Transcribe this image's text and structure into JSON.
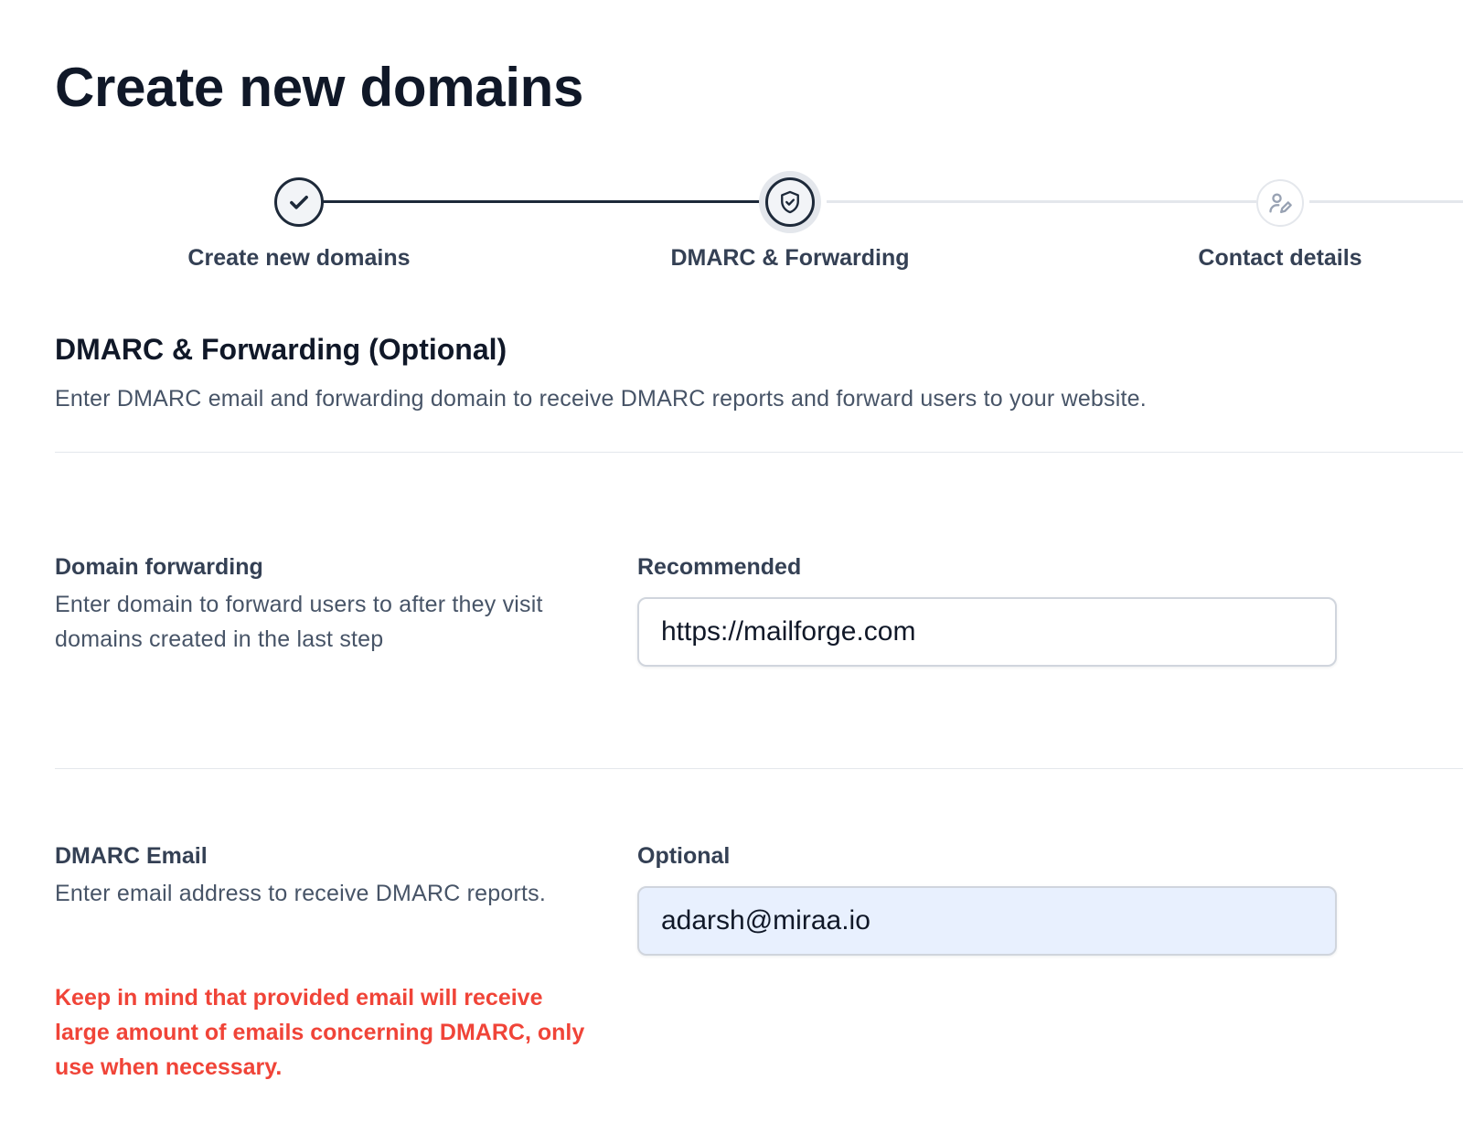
{
  "page": {
    "title": "Create new domains"
  },
  "stepper": {
    "steps": [
      {
        "label": "Create new domains",
        "state": "complete",
        "icon": "check-icon"
      },
      {
        "label": "DMARC & Forwarding",
        "state": "current",
        "icon": "shield-check-icon"
      },
      {
        "label": "Contact details",
        "state": "upcoming",
        "icon": "user-edit-icon"
      }
    ]
  },
  "section": {
    "title": "DMARC & Forwarding (Optional)",
    "description": "Enter DMARC email and forwarding domain to receive DMARC reports and forward users to your website."
  },
  "forwarding": {
    "title": "Domain forwarding",
    "help": "Enter domain to forward users to after they visit domains created in the last step",
    "input_label": "Recommended",
    "value": "https://mailforge.com"
  },
  "dmarc": {
    "title": "DMARC Email",
    "help": "Enter email address to receive DMARC reports.",
    "input_label": "Optional",
    "value": "adarsh@miraa.io",
    "warning": "Keep in mind that provided email will receive large amount of emails concerning DMARC, only use when necessary."
  },
  "colors": {
    "primary_text": "#101828",
    "secondary_text": "#475467",
    "step_active": "#1d2939",
    "step_inactive": "#e4e7ec",
    "warning": "#f04438",
    "autofill_bg": "#e8f0fe"
  }
}
